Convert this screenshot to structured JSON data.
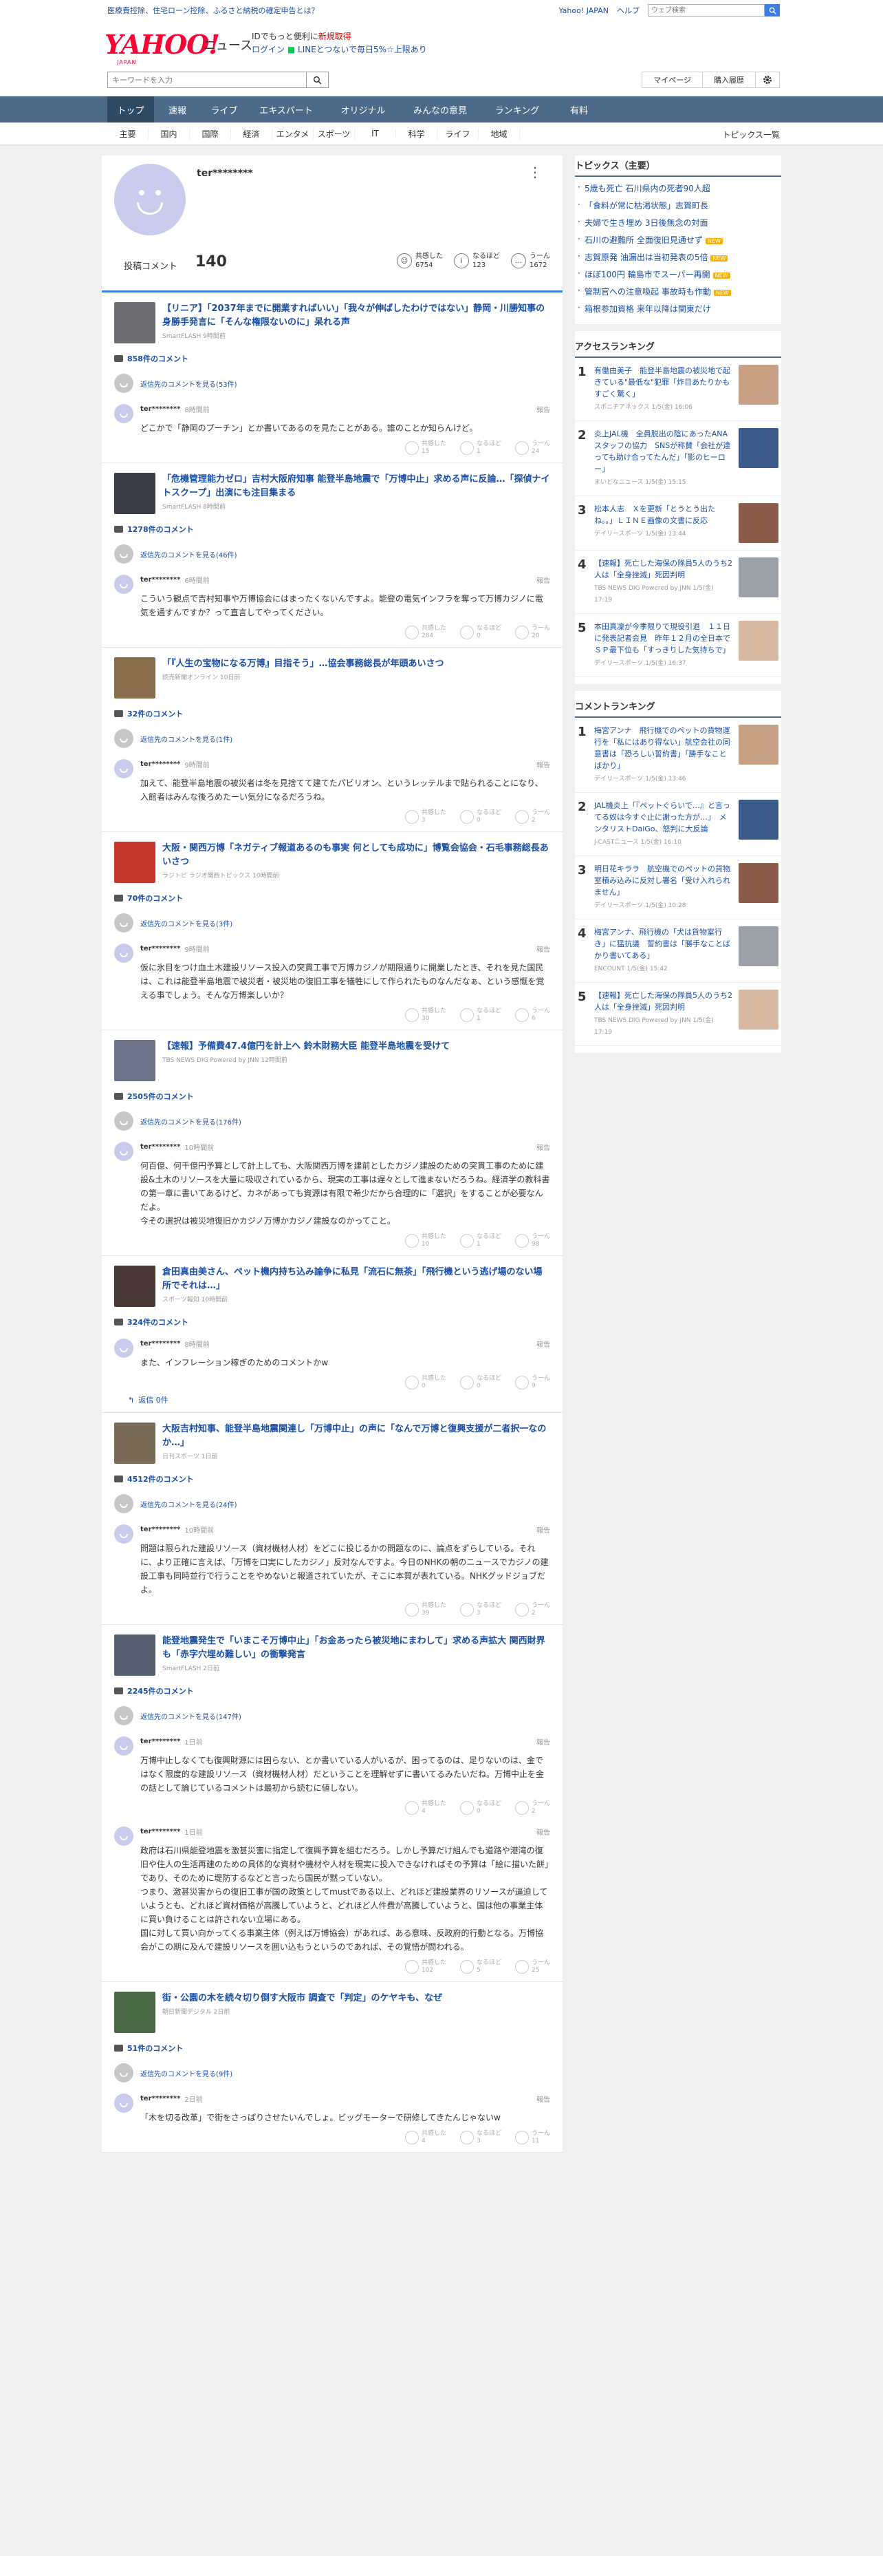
{
  "topbar": {
    "ad": "医療費控除、住宅ローン控除、ふるさと納税の確定申告とは？",
    "yahoo_japan": "Yahoo! JAPAN",
    "help": "ヘルプ",
    "search_placeholder": "ウェブ検索"
  },
  "brand": {
    "logo": "YAHOO!",
    "logo_sub": "JAPAN",
    "service": "ニュース",
    "promo_line1_prefix": "IDでもっと便利に",
    "promo_line1_link": "新規取得",
    "promo_line2_login": "ログイン",
    "promo_line2_rest": "LINEとつないで毎日5%☆上限あり"
  },
  "search": {
    "placeholder": "キーワードを入力",
    "mypage": "マイページ",
    "history": "購入履歴"
  },
  "nav": {
    "tabs": [
      "トップ",
      "速報",
      "ライブ",
      "エキスパート",
      "オリジナル",
      "みんなの意見",
      "ランキング",
      "有料"
    ],
    "sub": [
      "主要",
      "国内",
      "国際",
      "経済",
      "エンタメ",
      "スポーツ",
      "IT",
      "科学",
      "ライフ",
      "地域"
    ],
    "topics_list": "トピックス一覧"
  },
  "profile": {
    "name": "ter********",
    "count_label": "投稿コメント",
    "count": "140",
    "stats": [
      {
        "label": "共感した",
        "value": "6754"
      },
      {
        "label": "なるほど",
        "value": "123"
      },
      {
        "label": "うーん",
        "value": "1672"
      }
    ]
  },
  "labels": {
    "report": "報告",
    "empathy": "共感した",
    "naruhodo": "なるほど",
    "uun": "うーん",
    "reply": "返信"
  },
  "articles": [
    {
      "title": "【リニア】「2037年までに開業すればいい」「我々が伸ばしたわけではない」静岡・川勝知事の身勝手発言に「そんな権限ないのに」呆れる声",
      "source": "SmartFLASH 9時間前",
      "comment_count": "858件のコメント",
      "parent": "返信先のコメントを見る(53件)",
      "replies": [
        {
          "name": "ter********",
          "time": "8時間前",
          "text": "どこかで「静岡のプーチン」とか書いてあるのを見たことがある。誰のことか知らんけど。",
          "s1": "15",
          "s2": "1",
          "s3": "24"
        }
      ]
    },
    {
      "title": "「危機管理能力ゼロ」吉村大阪府知事 能登半島地震で「万博中止」求める声に反論…「探偵ナイトスクープ」出演にも注目集まる",
      "source": "SmartFLASH 8時間前",
      "comment_count": "1278件のコメント",
      "parent": "返信先のコメントを見る(46件)",
      "replies": [
        {
          "name": "ter********",
          "time": "6時間前",
          "text": "こういう観点で吉村知事や万博協会にはまったくないんですよ。能登の電気インフラを奪って万博カジノに電気を通すんですか？って直言してやってください。",
          "s1": "284",
          "s2": "0",
          "s3": "20"
        }
      ]
    },
    {
      "title": "「『人生の宝物になる万博』目指そう」…協会事務総長が年頭あいさつ",
      "source": "読売新聞オンライン 10日前",
      "comment_count": "32件のコメント",
      "parent": "返信先のコメントを見る(1件)",
      "replies": [
        {
          "name": "ter********",
          "time": "9時間前",
          "text": "加えて、能登半島地震の被災者は冬を見捨てて建てたパビリオン、というレッテルまで貼られることになり、入館者はみんな後ろめたーい気分になるだろうね。",
          "s1": "3",
          "s2": "0",
          "s3": "2"
        }
      ]
    },
    {
      "title": "大阪・関西万博「ネガティブ報道あるのも事実 何としても成功に」博覧会協会・石毛事務総長あいさつ",
      "source": "ラジトピ ラジオ関西トピックス 10時間前",
      "comment_count": "70件のコメント",
      "parent": "返信先のコメントを見る(3件)",
      "replies": [
        {
          "name": "ter********",
          "time": "9時間前",
          "text": "仮に氷目をつけ血土木建設リソース投入の突貫工事で万博カジノが期限通りに開業したとき、それを見た国民は、これは能登半島地震で被災者・被災地の復旧工事を犠牲にして作られたものなんだなぁ、という感慨を覚える事でしょう。そんな万博楽しいか？",
          "s1": "30",
          "s2": "1",
          "s3": "6"
        }
      ]
    },
    {
      "title": "【速報】予備費47.4億円を計上へ 鈴木財務大臣 能登半島地震を受けて",
      "source": "TBS NEWS DIG Powered by JNN 12時間前",
      "comment_count": "2505件のコメント",
      "parent": "返信先のコメントを見る(176件)",
      "replies": [
        {
          "name": "ter********",
          "time": "10時間前",
          "text": "何百億、何千億円予算として計上しても、大阪関西万博を建前としたカジノ建設のための突貫工事のために建設&土木のリソースを大量に吸収されているから、現実の工事は遅々として進まないだろうね。経済学の教科書の第一章に書いてあるけど、カネがあっても資源は有限で希少だから合理的に「選択」をすることが必要なんだよ。\n今その選択は被災地復旧かカジノ万博かカジノ建設なのかってこと。",
          "s1": "10",
          "s2": "1",
          "s3": "98"
        }
      ]
    },
    {
      "title": "倉田真由美さん、ペット機内持ち込み論争に私見「流石に無茶」「飛行機という逃げ場のない場所でそれは…」",
      "source": "スポーツ報知 10時間前",
      "comment_count": "324件のコメント",
      "parent": "",
      "replies": [
        {
          "name": "ter********",
          "time": "8時間前",
          "text": "また、インフレーション稼ぎのためのコメントかw",
          "s1": "0",
          "s2": "0",
          "s3": "9"
        }
      ],
      "reply_link": "返信 0件"
    },
    {
      "title": "大阪吉村知事、能登半島地震関連し「万博中止」の声に「なんで万博と復興支援が二者択一なのか…」",
      "source": "日刊スポーツ 1日前",
      "comment_count": "4512件のコメント",
      "parent": "返信先のコメントを見る(24件)",
      "replies": [
        {
          "name": "ter********",
          "time": "10時間前",
          "text": "問題は限られた建設リソース（資材機材人材）をどこに投じるかの問題なのに、論点をずらしている。それに、より正確に言えば、「万博を口実にしたカジノ」反対なんですよ。今日のNHKの朝のニュースでカジノの建設工事も同時並行で行うことをやめないと報道されていたが、そこに本質が表れている。NHKグッドジョブだよ。",
          "s1": "39",
          "s2": "3",
          "s3": "2"
        }
      ]
    },
    {
      "title": "能登地震発生で「いまこそ万博中止」「お金あったら被災地にまわして」求める声拡大 関西財界も「赤字穴埋め難しい」の衝撃発言",
      "source": "SmartFLASH 2日前",
      "comment_count": "2245件のコメント",
      "parent": "返信先のコメントを見る(147件)",
      "replies": [
        {
          "name": "ter********",
          "time": "1日前",
          "text": "万博中止しなくても復興財源には困らない、とか書いている人がいるが、困ってるのは、足りないのは、金ではなく限度的な建設リソース（資材機材人材）だということを理解せずに書いてるみたいだね。万博中止を金の話として論じているコメントは最初から読むに値しない。",
          "s1": "4",
          "s2": "0",
          "s3": "2"
        },
        {
          "name": "ter********",
          "time": "1日前",
          "text": "政府は石川県能登地震を激甚災害に指定して復興予算を組むだろう。しかし予算だけ組んでも道路や港湾の復旧や住人の生活再建のための具体的な資材や機材や人材を現実に投入できなければその予算は「絵に描いた餅」であり、そのために堤防するなどと言ったら国民が黙っていない。\nつまり、激甚災害からの復旧工事が国の政策としてmustである以上、どれほど建設業界のリソースが逼迫していようとも、どれほど資材価格が高騰していようと、どれほど人件費が高騰していようと、国は他の事業主体に買い負けることは許されない立場にある。\n国に対して買い向かってくる事業主体（例えば万博協会）があれば、ある意味、反政府的行動となる。万博協会がこの期に及んで建設リソースを囲い込もうというのであれば、その覚悟が問われる。",
          "s1": "102",
          "s2": "5",
          "s3": "25"
        }
      ]
    },
    {
      "title": "街・公園の木を続々切り倒す大阪市 調査で「判定」のケヤキも、なぜ",
      "source": "朝日新聞デジタル 2日前",
      "comment_count": "51件のコメント",
      "parent": "返信先のコメントを見る(9件)",
      "replies": [
        {
          "name": "ter********",
          "time": "2日前",
          "text": "「木を切る改革」で街をさっぱりさせたいんでしょ。ビッグモーターで研修してきたんじゃないw",
          "s1": "4",
          "s2": "3",
          "s3": "11"
        }
      ]
    }
  ],
  "sidebar": {
    "topics_title": "トピックス（主要）",
    "topics": [
      {
        "text": "5歳も死亡 石川県内の死者90人超",
        "new": false
      },
      {
        "text": "「食料が常に枯渇状態」志賀町長",
        "new": false
      },
      {
        "text": "夫婦で生き埋め 3日後無念の対面",
        "new": false
      },
      {
        "text": "石川の避難所 全面復旧見通せず",
        "new": true
      },
      {
        "text": "志賀原発 油漏出は当初発表の5倍",
        "new": true
      },
      {
        "text": "ほぼ100円 輪島市でスーパー再開",
        "new": true
      },
      {
        "text": "管制官への注意喚起 事故時も作動",
        "new": true
      },
      {
        "text": "箱根参加資格 来年以降は関東だけ",
        "new": false
      }
    ],
    "access_title": "アクセスランキング",
    "access": [
      {
        "n": "1",
        "title": "有働由美子　能登半島地震の被災地で起きている\"最低な\"犯罪「炸目あたりかもすごく驚く」",
        "src": "スポニチアネックス 1/5(金) 16:06"
      },
      {
        "n": "2",
        "title": "炎上JAL機　全員脱出の陰にあったANAスタッフの協力　SNSが称賛「会社が違っても助け合ってたんだ」「影のヒーロー」",
        "src": "まいどなニュース 1/5(金) 15:15"
      },
      {
        "n": "3",
        "title": "松本人志　Ｘを更新「とうとう出たね。。」ＬＩＮＥ画像の文書に反応",
        "src": "デイリースポーツ 1/5(金) 13:44"
      },
      {
        "n": "4",
        "title": "【速報】死亡した海保の隊員5人のうち2人は「全身挫滅」死因判明",
        "src": "TBS NEWS DIG Powered by JNN 1/5(金) 17:19"
      },
      {
        "n": "5",
        "title": "本田真凜が今季限りで現役引退　１１日に発表記者会見　昨年１２月の全日本でＳＰ最下位も「すっきりした気持ちで」",
        "src": "デイリースポーツ 1/5(金) 16:37"
      }
    ],
    "comment_title": "コメントランキング",
    "comment_rank": [
      {
        "n": "1",
        "title": "梅宮アンナ　飛行機でのペットの貨物運行を「私にはあり得ない」航空会社の同意書は「恐ろしい誓約書」「勝手なことばかり」",
        "src": "デイリースポーツ 1/5(金) 13:46"
      },
      {
        "n": "2",
        "title": "JAL機炎上「『ペットぐらいで…』と言ってる奴は今すぐ止に謝った方が…」　メンタリストDaiGo、怒判に大反論",
        "src": "J-CASTニュース 1/5(金) 16:10"
      },
      {
        "n": "3",
        "title": "明日花キララ　航空機でのペットの貨物室積み込みに反対し署名「受け入れられません」",
        "src": "デイリースポーツ 1/5(金) 10:28"
      },
      {
        "n": "4",
        "title": "梅宮アンナ、飛行機の「犬は貨物室行き」に猛抗議　誓約書は「勝手なことばかり書いてある」",
        "src": "ENCOUNT 1/5(金) 15:42"
      },
      {
        "n": "5",
        "title": "【速報】死亡した海保の隊員5人のうち2人は「全身挫滅」死因判明",
        "src": "TBS NEWS DIG Powered by JNN 1/5(金) 17:19"
      }
    ]
  },
  "colors": {
    "nav": "#4b6b89",
    "link": "#1a4ea6",
    "accent": "#3d7de0",
    "logo": "#ff0033"
  }
}
